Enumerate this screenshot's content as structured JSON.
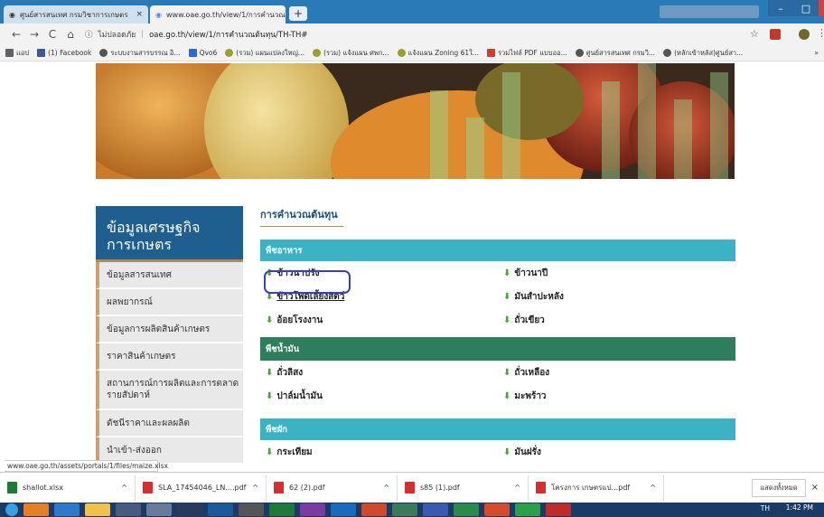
{
  "browser": {
    "tabs": [
      {
        "label": "ศูนย์สารสนเทศ กรมวิชาการเกษตร",
        "close": "×"
      },
      {
        "label": "www.oae.go.th/view/1/การคำนวณ",
        "close": "×"
      }
    ],
    "new_tab": "+",
    "nav": {
      "back": "←",
      "forward": "→",
      "reload": "C",
      "home": "⌂"
    },
    "address": {
      "security": "ไม่ปลอดภัย",
      "url": "oae.go.th/view/1/การคำนวณต้นทุน/TH-TH#"
    },
    "bookmarks": [
      {
        "label": "แอป",
        "color": "#5f6368"
      },
      {
        "label": "(1) Facebook",
        "color": "#3b5998"
      },
      {
        "label": "ระบบงานสารบรรณ อิ...",
        "color": "#555"
      },
      {
        "label": "Qvo6",
        "color": "#2a6ad6"
      },
      {
        "label": "(รวม) แผนแปลงใหญ่...",
        "color": "#9aa02a"
      },
      {
        "label": "(รวม) แจ้งแผน ศพก...",
        "color": "#9aa02a"
      },
      {
        "label": "แจ้งแผน Zoning 61ใ...",
        "color": "#9aa02a"
      },
      {
        "label": "รวมไฟล์ PDF แบบออ...",
        "color": "#d63a2a"
      },
      {
        "label": "ศูนย์สารสนเทศ กรมวิ...",
        "color": "#555"
      },
      {
        "label": "(หลักเข้าหลัส)ศูนย์สา...",
        "color": "#555"
      }
    ],
    "more": "»"
  },
  "sidebar": {
    "title_line1": "ข้อมูลเศรษฐกิจ",
    "title_line2": "การเกษตร",
    "items": [
      "ข้อมูลสารสนเทศ",
      "ผลพยากรณ์",
      "ข้อมูลการผลิตสินค้าเกษตร",
      "ราคาสินค้าเกษตร",
      "สถานการณ์การผลิตและการตลาดรายสัปดาห์",
      "ดัชนีราคาและผลผลิต",
      "นำเข้า-ส่งออก"
    ]
  },
  "main": {
    "title": "การคำนวณต้นทุน",
    "sections": [
      {
        "title": "พืชอาหาร",
        "color": "#3cb3c4",
        "items": [
          [
            "ข้าวนาปรัง",
            "ข้าวนาปี"
          ],
          [
            "ข้าวโพดเลี้ยงสัตว์",
            "มันสำปะหลัง"
          ],
          [
            "อ้อยโรงงาน",
            "ถั่วเขียว"
          ]
        ]
      },
      {
        "title": "พืชน้ำมัน",
        "color": "#2e7d5c",
        "items": [
          [
            "ถั่วลิสง",
            "ถั่วเหลือง"
          ],
          [
            "ปาล์มน้ำมัน",
            "มะพร้าว"
          ]
        ]
      },
      {
        "title": "พืชผัก",
        "color": "#3cb3c4",
        "items": [
          [
            "กระเทียม",
            "มันฝรั่ง"
          ]
        ]
      }
    ]
  },
  "status_url": "www.oae.go.th/assets/portals/1/files/maize.xlsx",
  "downloads": {
    "items": [
      {
        "name": "shallot.xlsx",
        "color": "#1f7a3a"
      },
      {
        "name": "SLA_17454046_LN....pdf",
        "color": "#d32f2f"
      },
      {
        "name": "62 (2).pdf",
        "color": "#d32f2f"
      },
      {
        "name": "s85 (1).pdf",
        "color": "#d32f2f"
      },
      {
        "name": "โครงการ เกษตรแป...pdf",
        "color": "#d32f2f"
      }
    ],
    "caret": "^",
    "show_all": "แสดงทั้งหมด",
    "close": "×"
  },
  "taskbar": {
    "clock": "1:42 PM",
    "lang": "TH"
  }
}
